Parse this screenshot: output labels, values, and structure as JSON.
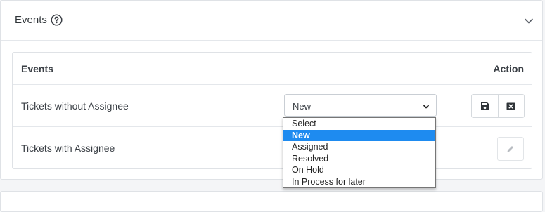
{
  "panel": {
    "title": "Events",
    "help_icon": "question-circle-icon",
    "collapse_icon": "chevron-down-icon"
  },
  "table": {
    "headers": {
      "events": "Events",
      "action": "Action"
    },
    "rows": [
      {
        "label": "Tickets without Assignee",
        "select_value": "New"
      },
      {
        "label": "Tickets with Assignee"
      }
    ]
  },
  "dropdown": {
    "options": [
      "Select",
      "New",
      "Assigned",
      "Resolved",
      "On Hold",
      "In Process for later"
    ],
    "selected": "New",
    "highlight_color": "#1e8bf0"
  },
  "icons": {
    "save": "save-icon",
    "cancel": "close-box-icon",
    "edit": "pencil-icon"
  }
}
